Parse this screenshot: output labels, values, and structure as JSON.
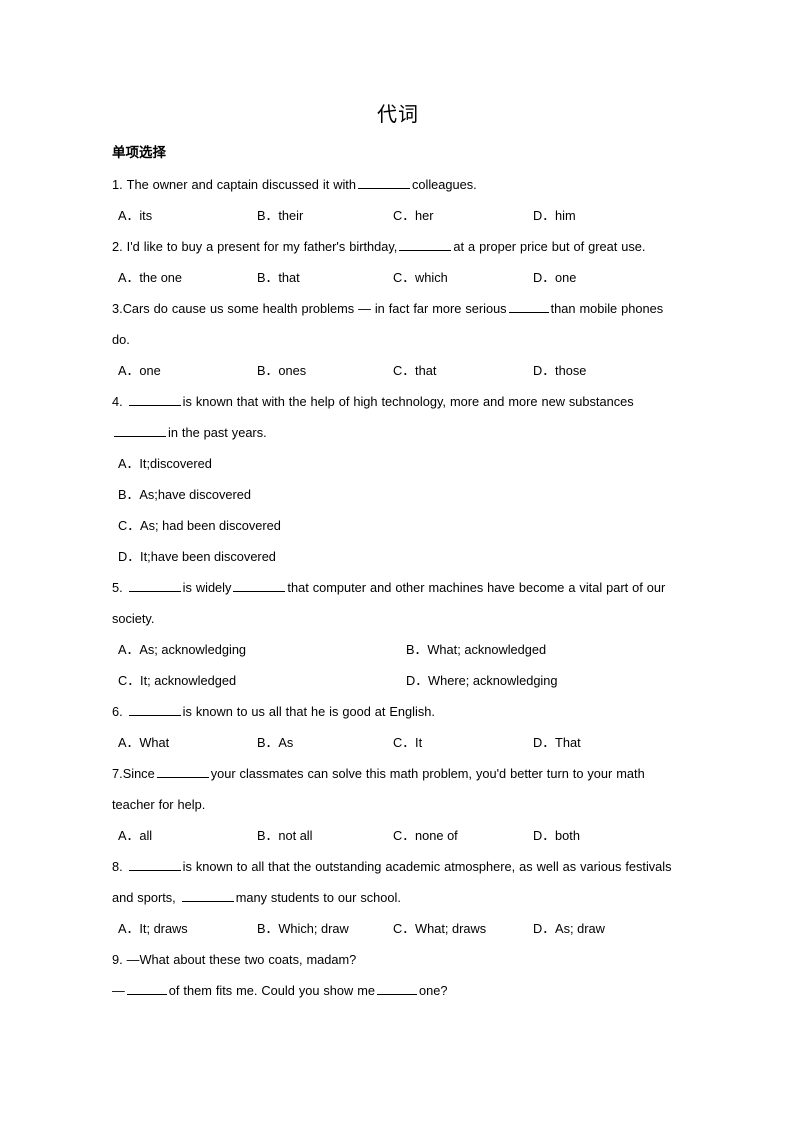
{
  "document": {
    "title": "代词",
    "section_heading": "单项选择"
  },
  "questions": [
    {
      "number": "1.",
      "stem_parts": [
        "The owner and captain discussed it with ",
        "BLANK_MD",
        " colleagues."
      ],
      "stem_text": "1． The owner and captain discussed it with ______ colleagues.",
      "layout": "four",
      "options": [
        {
          "letter": "A．",
          "text": "its"
        },
        {
          "letter": "B．",
          "text": "their"
        },
        {
          "letter": "C．",
          "text": "her"
        },
        {
          "letter": "D．",
          "text": "him"
        }
      ]
    },
    {
      "number": "2.",
      "stem_text": "2． I'd like to buy a present for my father's birthday, ______ at a proper price but of great use.",
      "stem_pre": "I'd like to buy a present for my father's birthday,",
      "stem_post": "at a proper price but of great use.",
      "layout": "four",
      "options": [
        {
          "letter": "A．",
          "text": "the one"
        },
        {
          "letter": "B．",
          "text": "that"
        },
        {
          "letter": "C．",
          "text": "which"
        },
        {
          "letter": "D．",
          "text": "one"
        }
      ]
    },
    {
      "number": "3.",
      "stem_text": "3．Cars do cause us some health problems — in fact far more serious _____ than mobile phones do.",
      "stem_pre": "Cars do cause us some health problems — in fact far more serious",
      "stem_post": "than mobile phones do.",
      "layout": "four",
      "options": [
        {
          "letter": "A．",
          "text": "one"
        },
        {
          "letter": "B．",
          "text": "ones"
        },
        {
          "letter": "C．",
          "text": "that"
        },
        {
          "letter": "D．",
          "text": "those"
        }
      ]
    },
    {
      "number": "4.",
      "stem_text": "4． _______ is known that with the help of high technology, more and more new substances_______ in the past years.",
      "stem_mid": "is known that with the help of high technology, more and more new substances",
      "stem_post": "in the past years.",
      "layout": "stacked",
      "options": [
        {
          "letter": "A．",
          "text": "It;discovered"
        },
        {
          "letter": "B．",
          "text": "As;have discovered"
        },
        {
          "letter": "C．",
          "text": "As; had been discovered"
        },
        {
          "letter": "D．",
          "text": "It;have been discovered"
        }
      ]
    },
    {
      "number": "5.",
      "stem_text": "5． _______is widely _______that computer and other machines have become a vital part of our society.",
      "stem_mid": "is widely",
      "stem_post": "that computer and other machines have become a vital part of our society.",
      "layout": "two",
      "options": [
        {
          "letter": "A．",
          "text": "As; acknowledging"
        },
        {
          "letter": "B．",
          "text": "What; acknowledged"
        },
        {
          "letter": "C．",
          "text": "It; acknowledged"
        },
        {
          "letter": "D．",
          "text": "Where; acknowledging"
        }
      ]
    },
    {
      "number": "6.",
      "stem_text": "6． ______ is known to us all that he is good at English.",
      "stem_post": "is known to us all that he is good at English.",
      "layout": "four",
      "options": [
        {
          "letter": "A．",
          "text": "What"
        },
        {
          "letter": "B．",
          "text": "As"
        },
        {
          "letter": "C．",
          "text": "It"
        },
        {
          "letter": "D．",
          "text": "That"
        }
      ]
    },
    {
      "number": "7.",
      "stem_text": "7．Since _______ your classmates can solve this math problem, you'd better turn to your math teacher for help.",
      "stem_pre": "Since",
      "stem_post": "your classmates can solve this math problem, you'd better turn to your math teacher for help.",
      "layout": "four",
      "options": [
        {
          "letter": "A．",
          "text": "all"
        },
        {
          "letter": "B．",
          "text": "not all"
        },
        {
          "letter": "C．",
          "text": "none of"
        },
        {
          "letter": "D．",
          "text": "both"
        }
      ]
    },
    {
      "number": "8.",
      "stem_text": "8． _______ is known to all that the outstanding academic atmosphere, as well as various festivals and sports, _______ many students to our school.",
      "stem_mid": "is known to all that the outstanding academic atmosphere, as well as various festivals and sports,",
      "stem_post": "many students to our school.",
      "layout": "four",
      "options": [
        {
          "letter": "A．",
          "text": "It; draws"
        },
        {
          "letter": "B．",
          "text": "Which; draw"
        },
        {
          "letter": "C．",
          "text": "What; draws"
        },
        {
          "letter": "D．",
          "text": "As; draw"
        }
      ]
    },
    {
      "number": "9.",
      "stem_text": "9． —What about these two coats, madam?",
      "dialog_line1": "—What about these two coats, madam?",
      "dialog_line2_pre": "—",
      "dialog_line2_mid": "of them fits me. Could you show me",
      "dialog_line2_post": "one?",
      "layout": "none",
      "options": []
    }
  ]
}
